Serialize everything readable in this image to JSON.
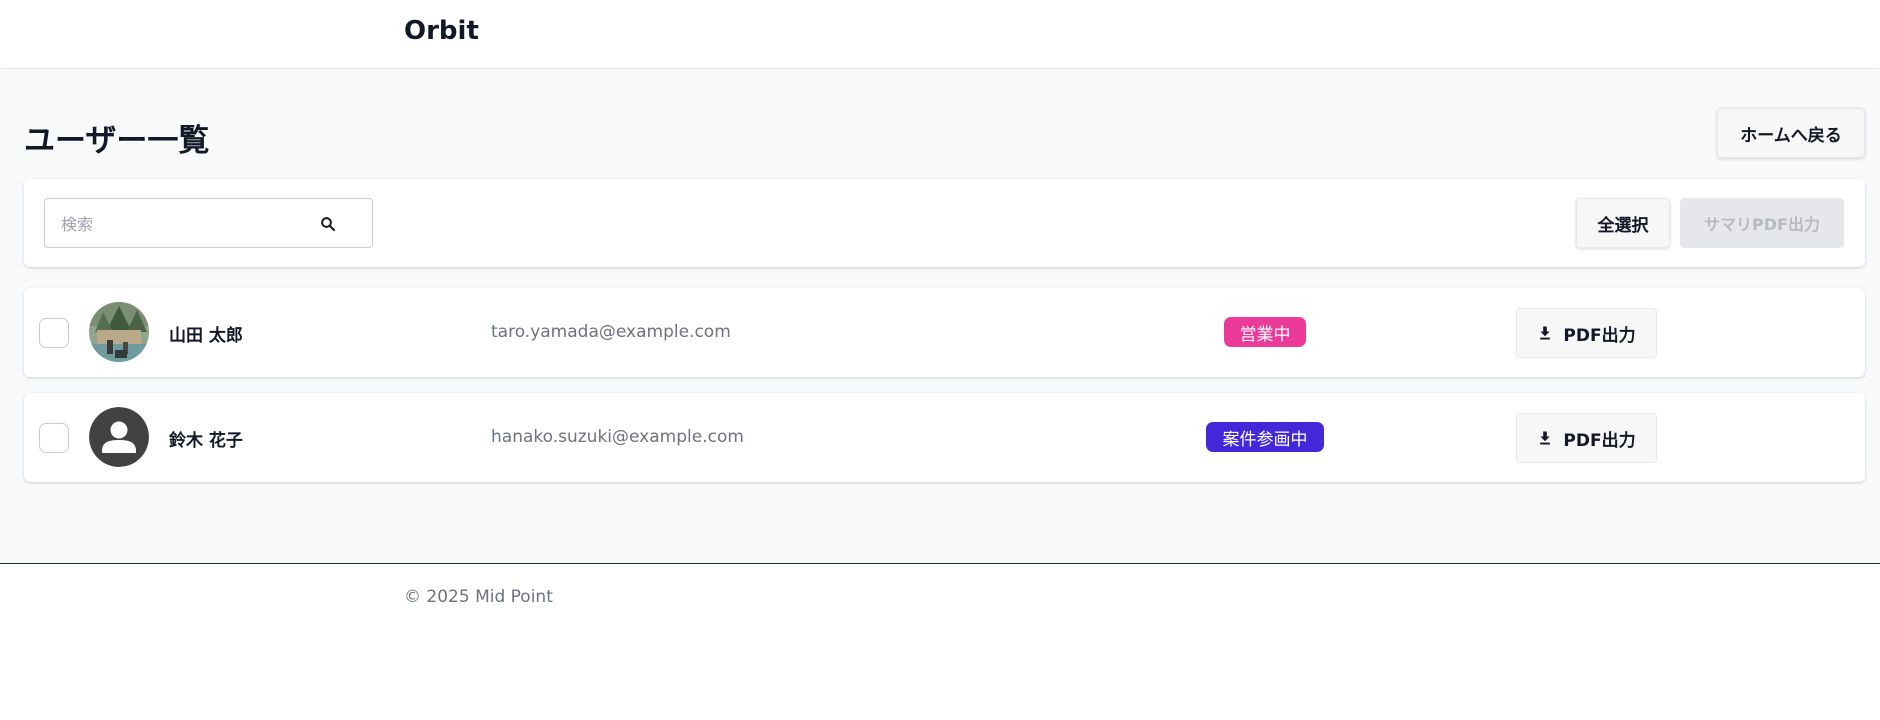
{
  "header": {
    "brand": "Orbit"
  },
  "page": {
    "title": "ユーザー一覧",
    "home_button_label": "ホームへ戻る"
  },
  "toolbar": {
    "search_placeholder": "検索",
    "search_value": "",
    "select_all_label": "全選択",
    "summary_pdf_label": "サマリPDF出力",
    "summary_pdf_disabled": true
  },
  "users": [
    {
      "name": "山田 太郎",
      "email": "taro.yamada@example.com",
      "status": "営業中",
      "status_color": "#ec3a9b",
      "avatar": "photo",
      "pdf_label": "PDF出力",
      "checked": false
    },
    {
      "name": "鈴木 花子",
      "email": "hanako.suzuki@example.com",
      "status": "案件参画中",
      "status_color": "#4228d9",
      "avatar": "default-person-icon",
      "pdf_label": "PDF出力",
      "checked": false
    }
  ],
  "footer": {
    "copyright": "© 2025 Mid Point"
  },
  "icons": {
    "search": "search-icon",
    "download": "download-icon",
    "default_avatar": "person-icon"
  },
  "colors": {
    "page_background": "#f8f9fb",
    "text_primary": "#111827",
    "text_secondary": "#6b7280"
  }
}
